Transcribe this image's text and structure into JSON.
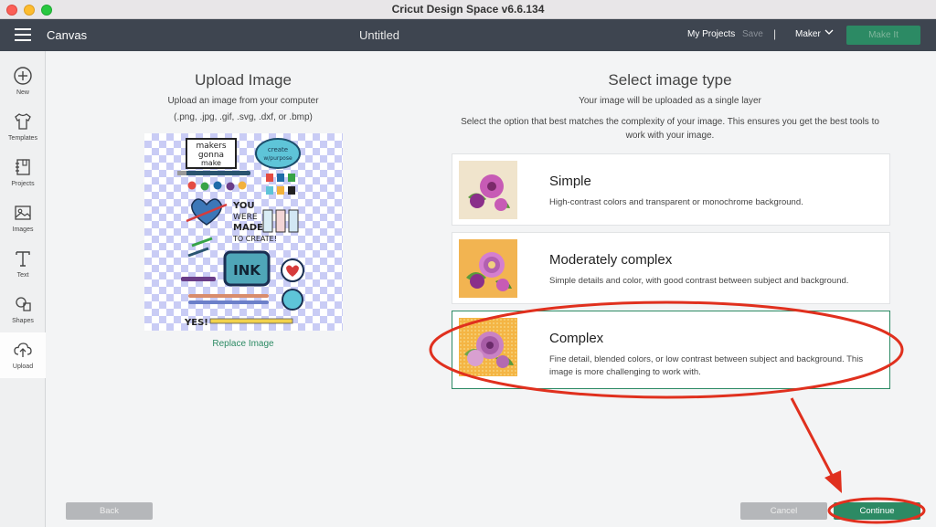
{
  "window": {
    "app_title": "Cricut Design Space  v6.6.134"
  },
  "toolbar": {
    "canvas_label": "Canvas",
    "doc_title": "Untitled",
    "my_projects": "My Projects",
    "save": "Save",
    "separator": "|",
    "machine": "Maker",
    "make_it": "Make It"
  },
  "sidebar": {
    "items": [
      {
        "label": "New",
        "icon": "plus-circle-icon"
      },
      {
        "label": "Templates",
        "icon": "tshirt-icon"
      },
      {
        "label": "Projects",
        "icon": "notebook-icon"
      },
      {
        "label": "Images",
        "icon": "image-icon"
      },
      {
        "label": "Text",
        "icon": "text-t-icon"
      },
      {
        "label": "Shapes",
        "icon": "shapes-icon"
      },
      {
        "label": "Upload",
        "icon": "cloud-upload-icon",
        "active": true
      }
    ]
  },
  "upload": {
    "heading": "Upload Image",
    "subtitle": "Upload an image from your computer",
    "formats": "(.png, .jpg, .gif, .svg, .dxf, or .bmp)",
    "replace": "Replace Image",
    "preview_texts": {
      "makers": "makers",
      "gonna": "gonna",
      "make": "make",
      "create1": "create",
      "create2": "w/purpose",
      "you": "YOU",
      "were": "WERE",
      "made": "MADE",
      "create3": "TO CREATE!",
      "ink": "INK",
      "yes": "YES!"
    }
  },
  "select": {
    "heading": "Select image type",
    "sub1": "Your image will be uploaded as a single layer",
    "sub2": "Select the option that best matches the complexity of your image. This ensures you get the best tools to work with your image.",
    "options": [
      {
        "title": "Simple",
        "desc": "High-contrast colors and transparent or monochrome background.",
        "thumb_bg": "#f0e4cc"
      },
      {
        "title": "Moderately complex",
        "desc": "Simple details and color, with good contrast between subject and background.",
        "thumb_bg": "#f2b451"
      },
      {
        "title": "Complex",
        "desc": "Fine detail, blended colors, or low contrast between subject and background. This image is more challenging to work with.",
        "thumb_bg": "#f4b544",
        "selected": true
      }
    ]
  },
  "footer": {
    "back": "Back",
    "cancel": "Cancel",
    "continue": "Continue"
  },
  "colors": {
    "accent": "#2c8a64",
    "toolbar": "#3e4550",
    "annotation": "#e0301e"
  }
}
